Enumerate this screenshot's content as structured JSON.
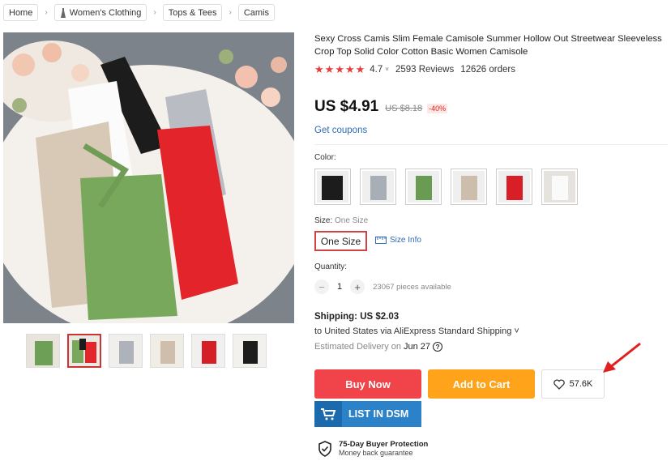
{
  "breadcrumb": [
    "Home",
    "Women's Clothing",
    "Tops & Tees",
    "Camis"
  ],
  "product": {
    "title": "Sexy Cross Camis Slim Female Camisole Summer Hollow Out Streetwear Sleeveless Crop Top Solid Color Cotton Basic Women Camisole",
    "rating": "4.7",
    "reviews": "2593 Reviews",
    "orders": "12626 orders",
    "price": "US $4.91",
    "old_price": "US $8.18",
    "discount": "-40%",
    "coupons": "Get coupons"
  },
  "color": {
    "label": "Color:",
    "swatches": [
      "black",
      "gray",
      "green",
      "beige",
      "red",
      "white"
    ]
  },
  "size": {
    "label": "Size:",
    "value": "One Size",
    "button": "One Size",
    "info": "Size Info"
  },
  "quantity": {
    "label": "Quantity:",
    "minus": "−",
    "value": "1",
    "plus": "+",
    "available": "23067 pieces available"
  },
  "shipping": {
    "title": "Shipping: US $2.03",
    "to": "to United States via AliExpress Standard Shipping ˅",
    "delivery_prefix": "Estimated Delivery on",
    "delivery_date": "Jun 27",
    "help": "?"
  },
  "actions": {
    "buy": "Buy Now",
    "cart": "Add to Cart",
    "wishlist": "57.6K",
    "dsm": "LIST IN DSM"
  },
  "protection": {
    "title": "75-Day Buyer Protection",
    "subtitle": "Money back guarantee"
  },
  "colors": {
    "accent_red": "#f0434a",
    "cart_orange": "#ffa31a",
    "dsm_blue": "#2c82c9",
    "link_blue": "#2e6ab8"
  }
}
